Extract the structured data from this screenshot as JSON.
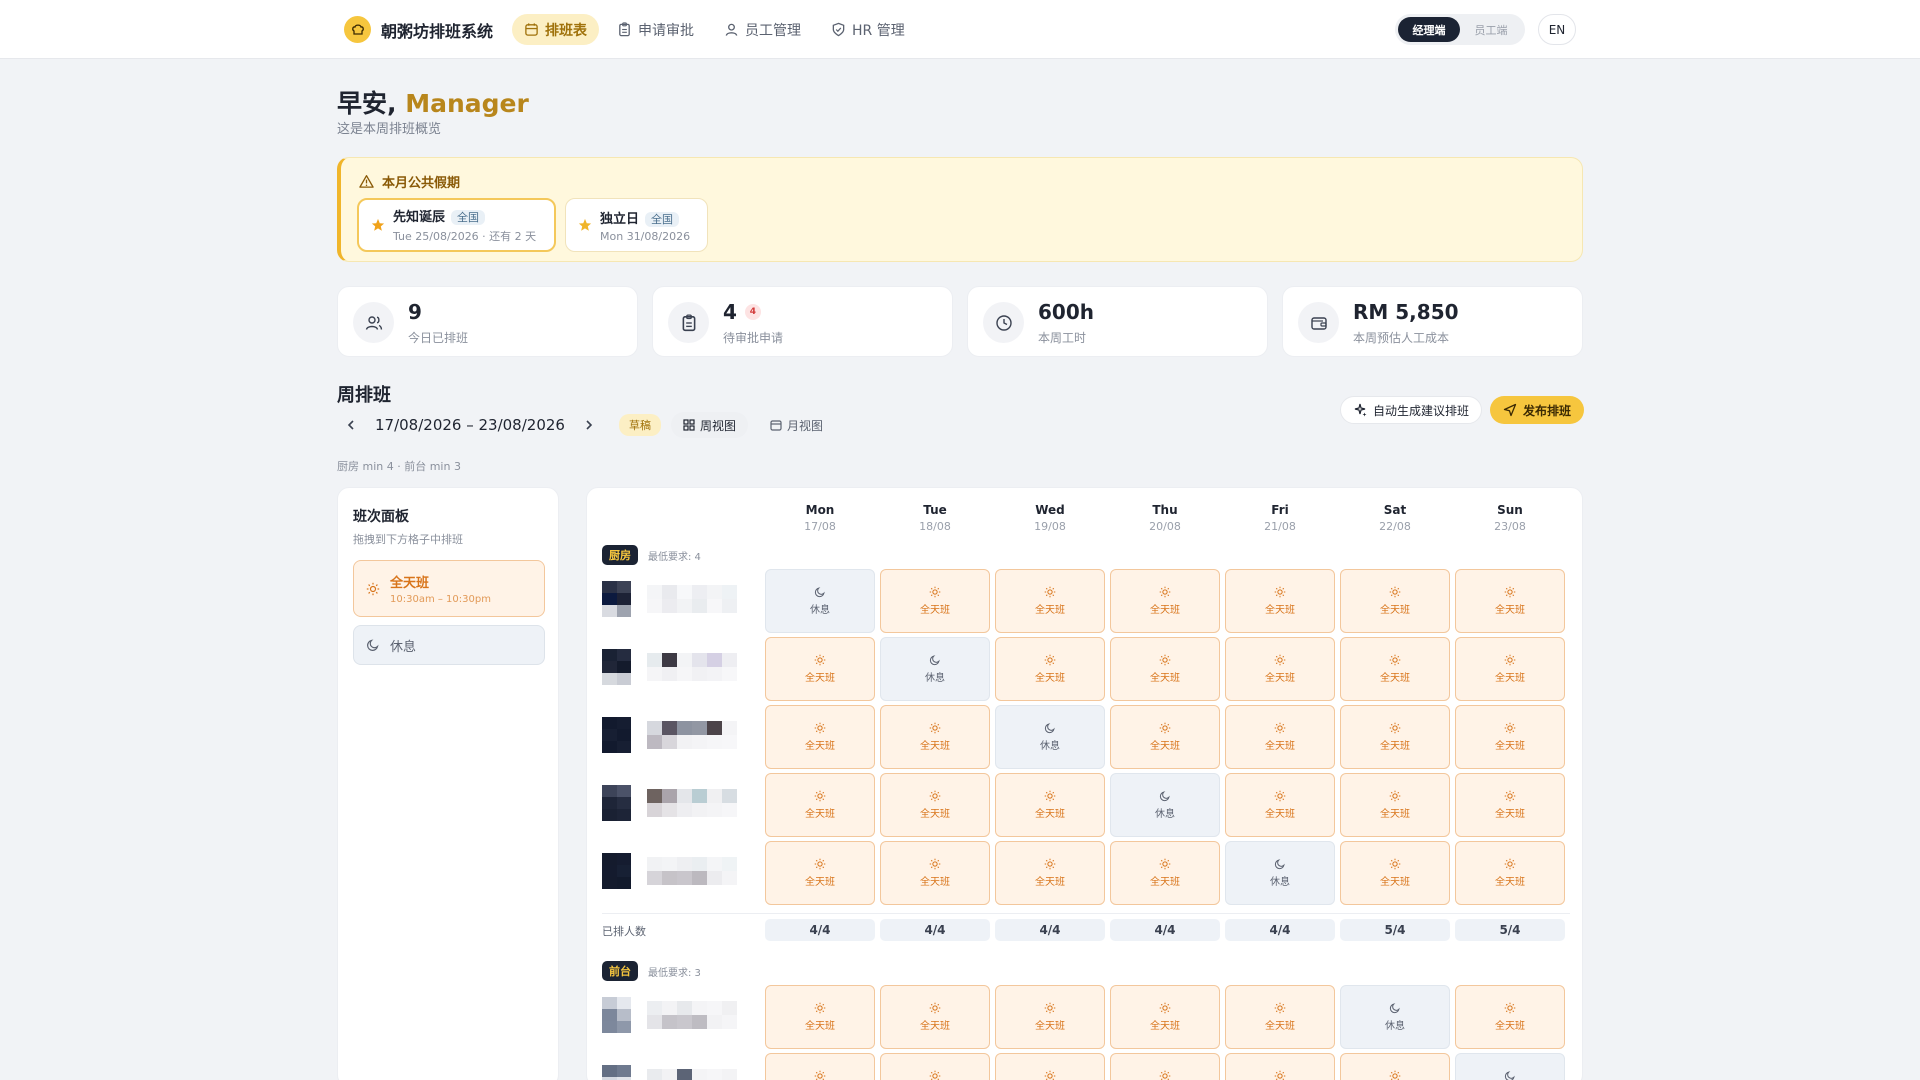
{
  "app": {
    "title": "朝粥坊排班系统"
  },
  "nav": [
    {
      "label": "排班表",
      "icon": "calendar-icon",
      "active": true
    },
    {
      "label": "申请审批",
      "icon": "clipboard-icon",
      "active": false
    },
    {
      "label": "员工管理",
      "icon": "user-icon",
      "active": false
    },
    {
      "label": "HR 管理",
      "icon": "shield-icon",
      "active": false
    }
  ],
  "roles": {
    "manager": "经理端",
    "employee": "员工端"
  },
  "lang": "EN",
  "greeting": {
    "hello": "早安, ",
    "name": "Manager",
    "subtitle": "这是本周排班概览"
  },
  "holidays": {
    "title": "本月公共假期",
    "items": [
      {
        "name": "先知诞辰",
        "scope": "全国",
        "date": "Tue 25/08/2026 · 还有 2 天"
      },
      {
        "name": "独立日",
        "scope": "全国",
        "date": "Mon 31/08/2026"
      }
    ]
  },
  "stats": [
    {
      "value": "9",
      "label": "今日已排班",
      "icon": "users-icon"
    },
    {
      "value": "4",
      "badge": "4",
      "label": "待审批申请",
      "icon": "clipboard-icon"
    },
    {
      "value": "600h",
      "label": "本周工时",
      "icon": "clock-icon"
    },
    {
      "value": "RM 5,850",
      "label": "本周预估人工成本",
      "icon": "wallet-icon"
    }
  ],
  "week": {
    "title": "周排班",
    "range": "17/08/2026 – 23/08/2026",
    "status": "草稿",
    "week_view": "周视图",
    "month_view": "月视图",
    "autogen": "自动生成建议排班",
    "publish": "发布排班",
    "min_req": "厨房 min 4 · 前台 min 3"
  },
  "panel": {
    "title": "班次面板",
    "subtitle": "拖拽到下方格子中排班",
    "day_shift": {
      "name": "全天班",
      "time": "10:30am – 10:30pm"
    },
    "rest": {
      "name": "休息"
    }
  },
  "days": [
    {
      "name": "Mon",
      "date": "17/08"
    },
    {
      "name": "Tue",
      "date": "18/08"
    },
    {
      "name": "Wed",
      "date": "19/08"
    },
    {
      "name": "Thu",
      "date": "20/08"
    },
    {
      "name": "Fri",
      "date": "21/08"
    },
    {
      "name": "Sat",
      "date": "22/08"
    },
    {
      "name": "Sun",
      "date": "23/08"
    }
  ],
  "labels": {
    "day_shift": "全天班",
    "rest": "休息",
    "assigned": "已排人数"
  },
  "departments": [
    {
      "name": "厨房",
      "min": "最低要求: 4",
      "rows": [
        [
          "rest",
          "day",
          "day",
          "day",
          "day",
          "day",
          "day"
        ],
        [
          "day",
          "rest",
          "day",
          "day",
          "day",
          "day",
          "day"
        ],
        [
          "day",
          "day",
          "rest",
          "day",
          "day",
          "day",
          "day"
        ],
        [
          "day",
          "day",
          "day",
          "rest",
          "day",
          "day",
          "day"
        ],
        [
          "day",
          "day",
          "day",
          "day",
          "rest",
          "day",
          "day"
        ]
      ],
      "counts": [
        "4/4",
        "4/4",
        "4/4",
        "4/4",
        "4/4",
        "5/4",
        "5/4"
      ]
    },
    {
      "name": "前台",
      "min": "最低要求: 3",
      "rows": [
        [
          "day",
          "day",
          "day",
          "day",
          "day",
          "rest",
          "day"
        ],
        [
          "day",
          "day",
          "day",
          "day",
          "day",
          "day",
          "rest"
        ]
      ]
    }
  ],
  "colors": {
    "accent": "#f6c63e",
    "navy": "#1b2333",
    "shift_bg": "#fff3e7",
    "shift_text": "#d8741a",
    "rest_bg": "#eef2f7"
  }
}
